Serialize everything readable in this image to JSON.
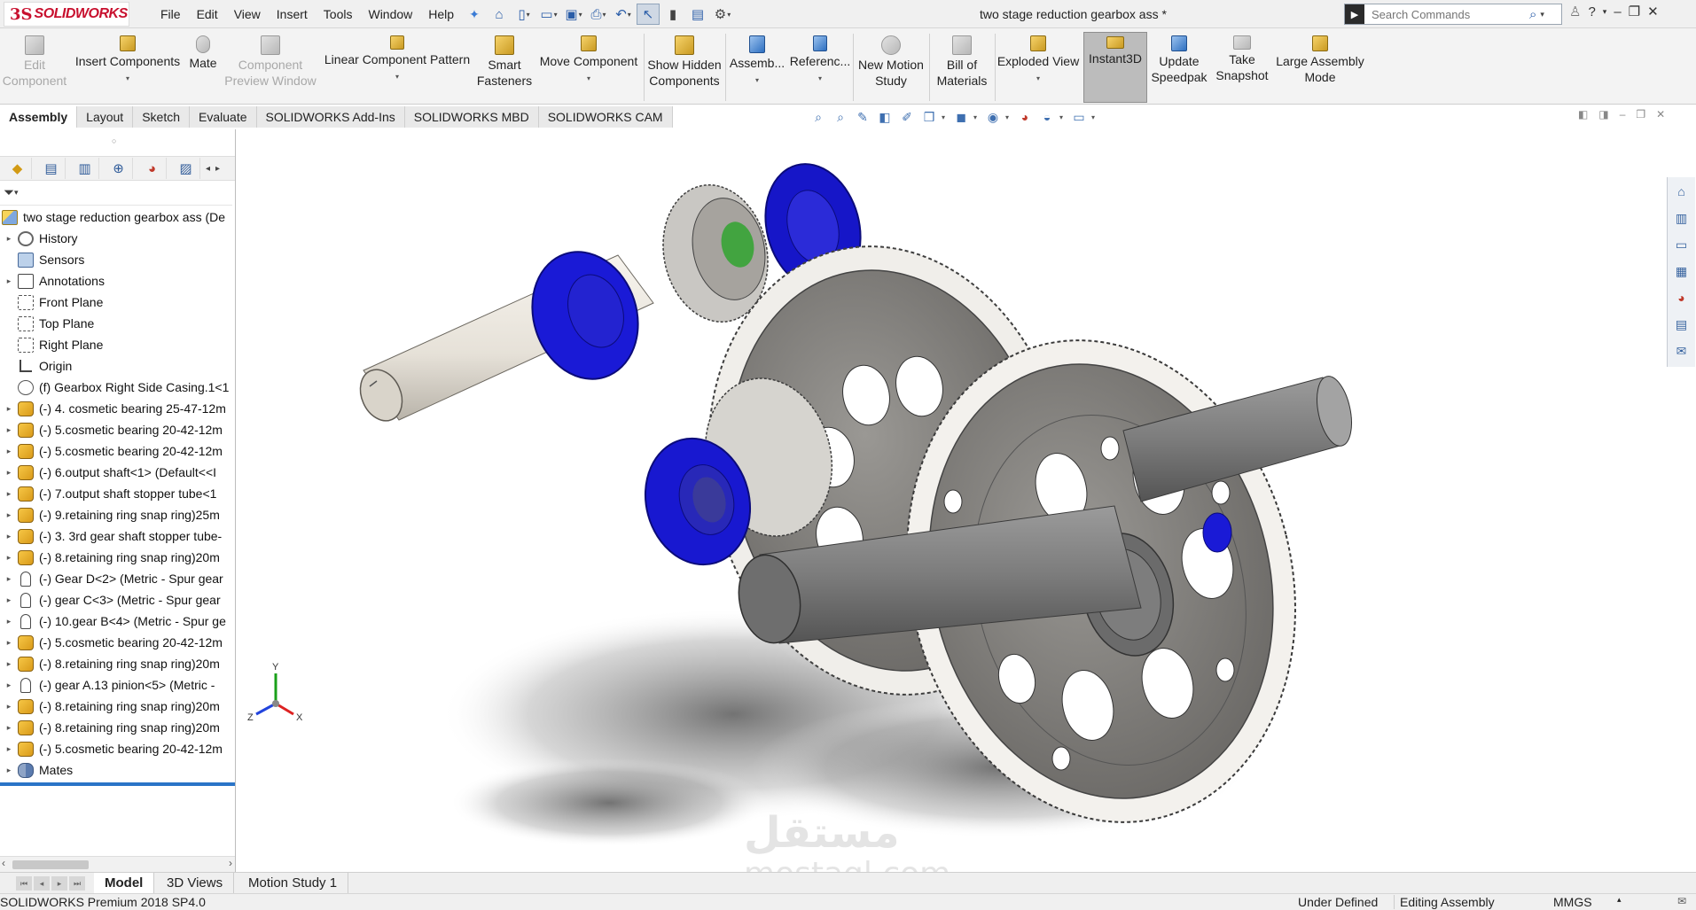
{
  "app": {
    "logo_ds": "3S",
    "logo_text": "SOLIDWORKS",
    "document_title": "two stage reduction gearbox ass *"
  },
  "menu": [
    "File",
    "Edit",
    "View",
    "Insert",
    "Tools",
    "Window",
    "Help"
  ],
  "search": {
    "placeholder": "Search Commands"
  },
  "command_manager": [
    {
      "label1": "Edit",
      "label2": "Component",
      "disabled": true
    },
    {
      "label1": "Insert Components",
      "label2": "",
      "disabled": false
    },
    {
      "label1": "Mate",
      "label2": "",
      "disabled": false
    },
    {
      "label1": "Component",
      "label2": "Preview Window",
      "disabled": true
    },
    {
      "label1": "Linear Component Pattern",
      "label2": "",
      "disabled": false
    },
    {
      "label1": "Smart",
      "label2": "Fasteners",
      "disabled": false
    },
    {
      "label1": "Move Component",
      "label2": "",
      "disabled": false
    },
    {
      "label1": "Show Hidden",
      "label2": "Components",
      "disabled": false
    },
    {
      "label1": "Assemb...",
      "label2": "",
      "disabled": false
    },
    {
      "label1": "Referenc...",
      "label2": "",
      "disabled": false
    },
    {
      "label1": "New Motion",
      "label2": "Study",
      "disabled": false
    },
    {
      "label1": "Bill of",
      "label2": "Materials",
      "disabled": false
    },
    {
      "label1": "Exploded View",
      "label2": "",
      "disabled": false
    },
    {
      "label1": "Instant3D",
      "label2": "",
      "disabled": false
    },
    {
      "label1": "Update",
      "label2": "Speedpak",
      "disabled": false
    },
    {
      "label1": "Take",
      "label2": "Snapshot",
      "disabled": false
    },
    {
      "label1": "Large Assembly",
      "label2": "Mode",
      "disabled": false
    }
  ],
  "tabs": [
    "Assembly",
    "Layout",
    "Sketch",
    "Evaluate",
    "SOLIDWORKS Add-Ins",
    "SOLIDWORKS MBD",
    "SOLIDWORKS CAM"
  ],
  "tree": {
    "root": "two stage reduction gearbox ass  (De",
    "items": [
      {
        "label": "History",
        "icon": "history-icon",
        "expand": true
      },
      {
        "label": "Sensors",
        "icon": "sensors-icon",
        "expand": false
      },
      {
        "label": "Annotations",
        "icon": "annotations-icon",
        "expand": true
      },
      {
        "label": "Front Plane",
        "icon": "plane-icon",
        "expand": false
      },
      {
        "label": "Top Plane",
        "icon": "plane-icon",
        "expand": false
      },
      {
        "label": "Right Plane",
        "icon": "plane-icon",
        "expand": false
      },
      {
        "label": "Origin",
        "icon": "origin-icon",
        "expand": false
      },
      {
        "label": "(f) Gearbox Right Side Casing.1<1",
        "icon": "casing-part-icon",
        "expand": false
      },
      {
        "label": "(-) 4. cosmetic bearing 25-47-12m",
        "icon": "part-icon",
        "expand": true
      },
      {
        "label": "(-) 5.cosmetic bearing 20-42-12m",
        "icon": "part-icon",
        "expand": true
      },
      {
        "label": "(-) 5.cosmetic bearing 20-42-12m",
        "icon": "part-icon",
        "expand": true
      },
      {
        "label": "(-) 6.output shaft<1> (Default<<I",
        "icon": "part-icon",
        "expand": true
      },
      {
        "label": "(-) 7.output shaft stopper tube<1",
        "icon": "part-icon",
        "expand": true
      },
      {
        "label": "(-) 9.retaining ring snap ring)25m",
        "icon": "part-icon",
        "expand": true
      },
      {
        "label": "(-) 3. 3rd gear shaft stopper tube-",
        "icon": "part-icon",
        "expand": true
      },
      {
        "label": "(-) 8.retaining ring snap ring)20m",
        "icon": "part-icon",
        "expand": true
      },
      {
        "label": "(-) Gear D<2> (Metric - Spur gear",
        "icon": "toolbox-gear-icon",
        "expand": true
      },
      {
        "label": "(-) gear C<3> (Metric - Spur gear",
        "icon": "toolbox-gear-icon",
        "expand": true
      },
      {
        "label": "(-) 10.gear B<4> (Metric - Spur ge",
        "icon": "toolbox-gear-icon",
        "expand": true
      },
      {
        "label": "(-) 5.cosmetic bearing 20-42-12m",
        "icon": "part-icon",
        "expand": true
      },
      {
        "label": "(-) 8.retaining ring snap ring)20m",
        "icon": "part-icon",
        "expand": true
      },
      {
        "label": "(-) gear A.13 pinion<5> (Metric -",
        "icon": "toolbox-gear-icon",
        "expand": true
      },
      {
        "label": "(-) 8.retaining ring snap ring)20m",
        "icon": "part-icon",
        "expand": true
      },
      {
        "label": "(-) 8.retaining ring snap ring)20m",
        "icon": "part-icon",
        "expand": true
      },
      {
        "label": "(-) 5.cosmetic bearing 20-42-12m",
        "icon": "part-icon",
        "expand": true
      },
      {
        "label": "Mates",
        "icon": "mates-icon",
        "expand": true
      }
    ]
  },
  "triad": {
    "x": "X",
    "y": "Y",
    "z": "Z"
  },
  "watermark": {
    "arabic": "مستقل",
    "latin": "mostaql.com"
  },
  "bottom_tabs": [
    "Model",
    "3D Views",
    "Motion Study 1"
  ],
  "status": {
    "product": "SOLIDWORKS Premium 2018 SP4.0",
    "definition": "Under Defined",
    "mode": "Editing Assembly",
    "units": "MMGS"
  },
  "colors": {
    "bearing_blue": "#1a1ad6",
    "accent_red": "#c8102e",
    "tree_bar": "#2a74c7"
  }
}
